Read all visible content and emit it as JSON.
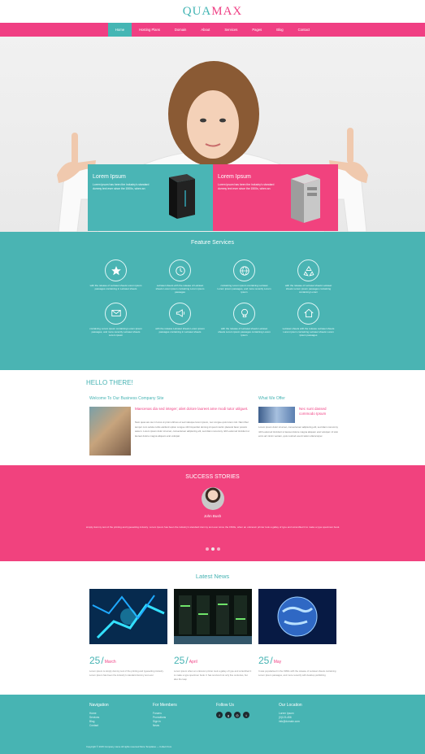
{
  "brand": {
    "logo_a": "QUA",
    "logo_b": "MAX"
  },
  "nav": {
    "items": [
      "Home",
      "Hosting Plans",
      "Domain",
      "About",
      "Services",
      "Pages",
      "Blog",
      "Contact"
    ],
    "active": "Home"
  },
  "hero": {
    "box_left": {
      "title": "Lorem Ipsum",
      "text": "Lorem ipsum has been the industry's standard dummy text ever since the 1500s, when an"
    },
    "box_right": {
      "title": "Lorem Ipsum",
      "text": "Lorem ipsum has been the industry's standard dummy text ever since the 1500s, when an"
    }
  },
  "features": {
    "title": "Feature Services",
    "items": [
      {
        "icon": "star-icon",
        "text": "with the release of Letraset sheets Lorem ipsum passages containing in Letraset sheets"
      },
      {
        "icon": "clock-icon",
        "text": "Letraset sheets with the release of Letraset sheets Lorem ipsum containing Lorem ipsum passages"
      },
      {
        "icon": "globe-icon",
        "text": "containing Lorem ipsum containing Letraset Lorem ipsum passages, and more recently Lorem ipsum"
      },
      {
        "icon": "recycle-icon",
        "text": "with the release of Letraset sheets Letraset sheets Lorem ipsum passages containing containing Lorem"
      },
      {
        "icon": "mail-icon",
        "text": "containing Lorem ipsum containing Lorem ipsum passages, and more recently Letraset sheets Lorem ipsum"
      },
      {
        "icon": "megaphone-icon",
        "text": "with the release Letraset sheets Lorem ipsum passages containing in Letraset sheets"
      },
      {
        "icon": "bulb-icon",
        "text": "with the release of Letraset sheets Letraset sheets Lorem ipsum passages containing Lorem ipsum"
      },
      {
        "icon": "home-icon",
        "text": "Letraset sheets with the release Letraset sheets Lorem ipsum containing Letraset sheets Lorem ipsum passages"
      }
    ]
  },
  "hello": {
    "title": "HELLO THERE!",
    "welcome": "Welcome To Our Business Company Site",
    "subtitle": "Maecenas dia sed integer; aliet dolore laoreet ame modi tutor utilguet.",
    "body": "Nam quas are we in locus ut proin ultrices et sed natoque lorem ipsum, nec congue quis lorem nisl. Nam liber tempor cum soluta nobis eleifend option congue nihil imperdiet doming id quod mazim placerat facer possim assum. Lorem ipsum dolor sit amet, consectetuer adipiscing elit, sed diam nonummy nibh euismod tincidunt ut laoreet dolore magna aliquam erat volutpat."
  },
  "offer": {
    "title": "What We Offer",
    "subtitle": "Nec sunt dassed commodo Ipsum",
    "body": "Lorem ipsum dolor sit amet, consectetuer adipiscing elit, sed diam nonummy nibh euismod tincidunt ut laoreet dolore magna aliquam erat volutpat. Ut wisi enim ad minim veniam, quis nostrud exerci tation ullamcorper."
  },
  "success": {
    "title": "SUCCESS STORIES",
    "name": "John Bush",
    "text": "simply dummy text of the printing and typesetting industry. Lorem Ipsum has been the industry's standard dummy text ever since the 1500s, when an unknown printer took a galley of type and scrambled it to make a type specimen book."
  },
  "news": {
    "title": "Latest News",
    "items": [
      {
        "day": "25",
        "month": "March",
        "text": "Lorem ipsum is simply dummy text of the printing and typesetting industry. Lorem Ipsum has been the industry's standard dummy text ever"
      },
      {
        "day": "25",
        "month": "April",
        "text": "Lorem ipsum when an unknown printer took a galley of type and scrambled it to make a type specimen book. It has survived not only five centuries, but also the leap"
      },
      {
        "day": "25",
        "month": "May",
        "text": "It was popularised in the 1960s with the release of Letraset sheets containing Lorem Ipsum passages, and more recently with desktop publishing"
      }
    ]
  },
  "footer": {
    "navigation": {
      "title": "Navigation",
      "links": [
        "Home",
        "Services",
        "Blog",
        "Contact"
      ]
    },
    "members": {
      "title": "For Members",
      "links": [
        "Forums",
        "Promotions",
        "Sign in",
        "News"
      ]
    },
    "follow": {
      "title": "Follow Us",
      "icons": [
        "facebook-icon",
        "google-plus-icon",
        "instagram-icon",
        "twitter-icon"
      ]
    },
    "location": {
      "title": "Our Location",
      "lines": [
        "Lorem Ipsum",
        "(0)123-456",
        "info@domain.com"
      ]
    },
    "copyright": "Copyright © 2015 Company name All rights reserved More Templates — Collect from"
  },
  "colors": {
    "teal": "#4ab5b5",
    "pink": "#f1427e"
  }
}
